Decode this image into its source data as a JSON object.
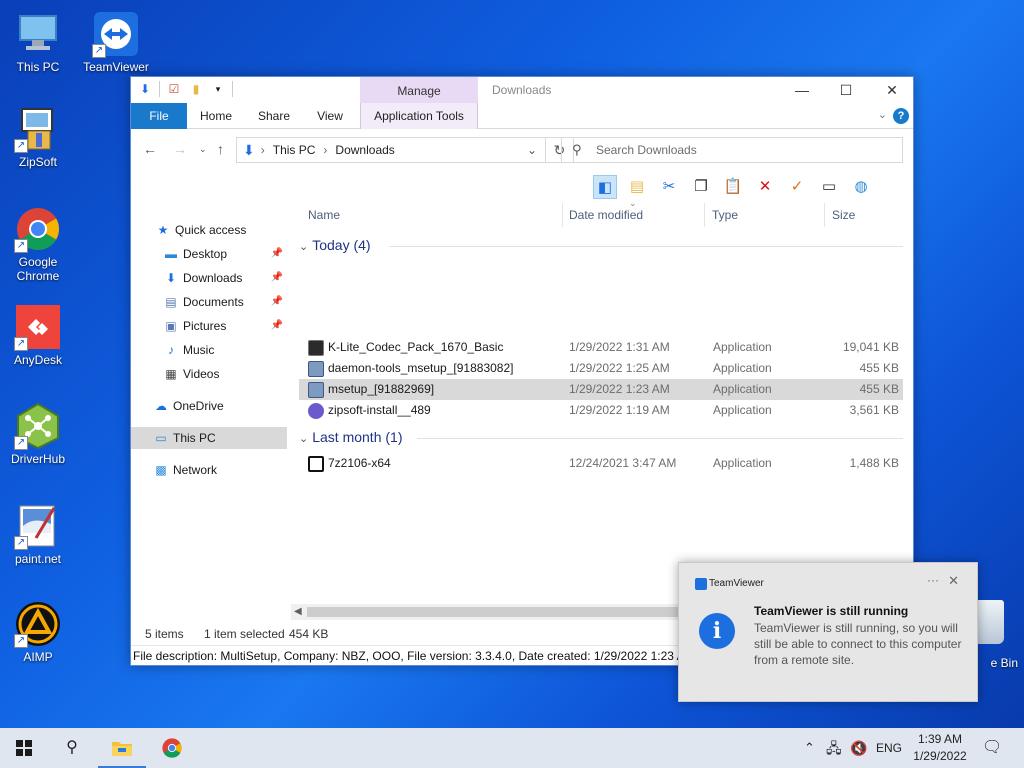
{
  "desktop": {
    "icons": [
      {
        "label": "This PC"
      },
      {
        "label": "TeamViewer"
      },
      {
        "label": "ZipSoft"
      },
      {
        "label": "Google Chrome"
      },
      {
        "label": "AnyDesk"
      },
      {
        "label": "DriverHub"
      },
      {
        "label": "paint.net"
      },
      {
        "label": "AIMP"
      }
    ],
    "recycle_partial": "e Bin"
  },
  "explorer": {
    "title": "Downloads",
    "context_tab_header": "Manage",
    "tabs": [
      "File",
      "Home",
      "Share",
      "View",
      "Application Tools"
    ],
    "address": {
      "root": "This PC",
      "current": "Downloads"
    },
    "search_placeholder": "Search Downloads",
    "columns": {
      "name": "Name",
      "date": "Date modified",
      "type": "Type",
      "size": "Size"
    },
    "nav": {
      "quick_access": "Quick access",
      "desktop": "Desktop",
      "downloads": "Downloads",
      "documents": "Documents",
      "pictures": "Pictures",
      "music": "Music",
      "videos": "Videos",
      "onedrive": "OneDrive",
      "thispc": "This PC",
      "network": "Network"
    },
    "groups": [
      {
        "label": "Today (4)"
      },
      {
        "label": "Last month (1)"
      }
    ],
    "files": [
      {
        "name": "K-Lite_Codec_Pack_1670_Basic",
        "date": "1/29/2022 1:31 AM",
        "type": "Application",
        "size": "19,041 KB"
      },
      {
        "name": "daemon-tools_msetup_[91883082]",
        "date": "1/29/2022 1:25 AM",
        "type": "Application",
        "size": "455 KB"
      },
      {
        "name": "msetup_[91882969]",
        "date": "1/29/2022 1:23 AM",
        "type": "Application",
        "size": "455 KB"
      },
      {
        "name": "zipsoft-install__489",
        "date": "1/29/2022 1:19 AM",
        "type": "Application",
        "size": "3,561 KB"
      },
      {
        "name": "7z2106-x64",
        "date": "12/24/2021 3:47 AM",
        "type": "Application",
        "size": "1,488 KB"
      }
    ],
    "status": {
      "items": "5 items",
      "selected": "1 item selected",
      "size": "454 KB"
    },
    "description": "File description: MultiSetup, Company: NBZ, OOO, File version: 3.3.4.0, Date created: 1/29/2022 1:23 AM"
  },
  "toast": {
    "app": "TeamViewer",
    "heading": "TeamViewer is still running",
    "body": "TeamViewer is still running, so you will still be able to connect to this computer from a remote site."
  },
  "taskbar": {
    "language": "ENG",
    "time": "1:39 AM",
    "date": "1/29/2022"
  }
}
